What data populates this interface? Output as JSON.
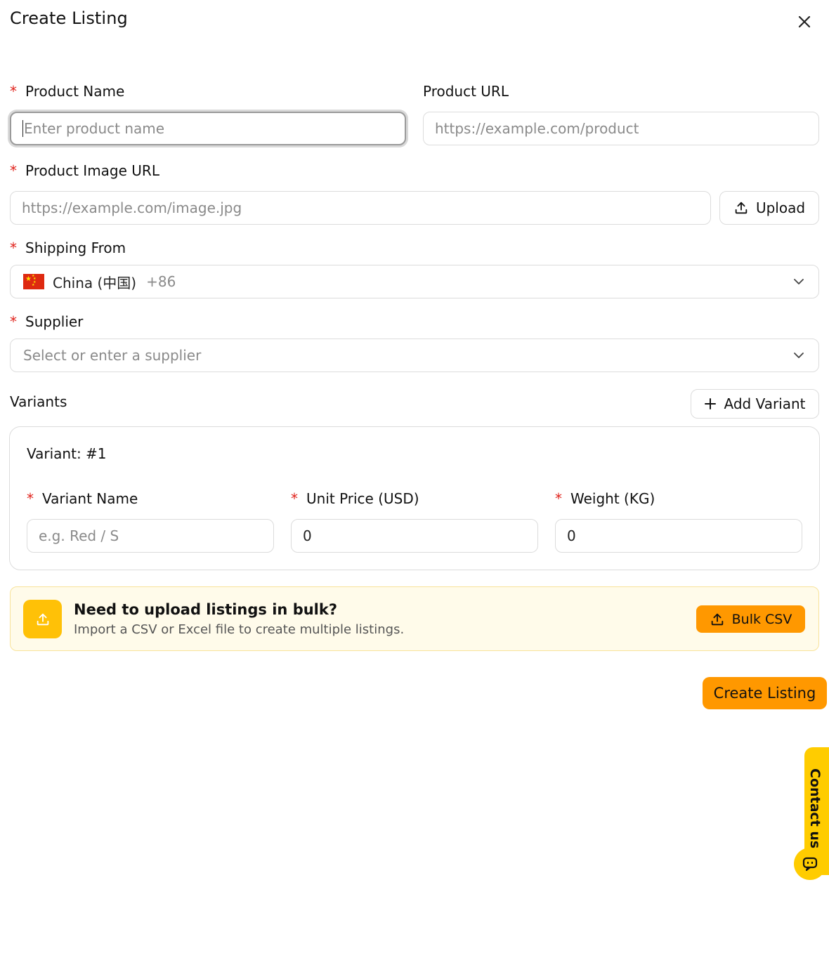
{
  "modal": {
    "title": "Create Listing"
  },
  "form": {
    "product_name": {
      "label": "Product Name",
      "placeholder": "Enter product name",
      "required": true
    },
    "product_url": {
      "label": "Product URL",
      "placeholder": "https://example.com/product",
      "required": false
    },
    "product_image_url": {
      "label": "Product Image URL",
      "placeholder": "https://example.com/image.jpg",
      "required": true
    },
    "upload_label": "Upload",
    "shipping_from": {
      "label": "Shipping From",
      "country": "China (中国)",
      "dial_code": "+86",
      "required": true
    },
    "supplier": {
      "label": "Supplier",
      "placeholder": "Select or enter a supplier",
      "required": true
    },
    "required_marker": "*"
  },
  "variants": {
    "section_label": "Variants",
    "add_label": "Add Variant",
    "items": [
      {
        "title": "Variant: #1",
        "name": {
          "label": "Variant Name",
          "placeholder": "e.g. Red / S"
        },
        "price": {
          "label": "Unit Price (USD)",
          "value": "0"
        },
        "weight": {
          "label": "Weight (KG)",
          "value": "0"
        }
      }
    ]
  },
  "bulk": {
    "title": "Need to upload listings in bulk?",
    "subtitle": "Import a CSV or Excel file to create multiple listings.",
    "button_label": "Bulk CSV"
  },
  "submit_label": "Create Listing",
  "contact": {
    "label": "Contact us"
  },
  "colors": {
    "accent": "#ff9800",
    "required": "#e0221b",
    "bulk_bg": "#fffbea",
    "contact": "#ffcc00"
  },
  "icons": {
    "close": "close-icon",
    "upload": "upload-icon",
    "chevron": "chevron-down-icon",
    "plus": "plus-icon",
    "flag": "china-flag-icon",
    "chat": "chat-icon"
  }
}
